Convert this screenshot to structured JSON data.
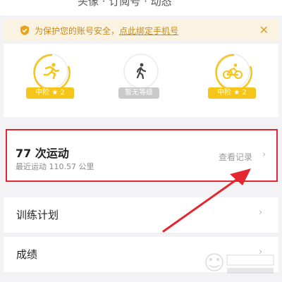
{
  "header": {
    "partial_text": "头像 · 订阅号 · 动态"
  },
  "notice": {
    "prefix": "为保护您的账号安全，",
    "link": "点此绑定手机号",
    "close_glyph": "✕"
  },
  "badges": [
    {
      "icon": "running-icon",
      "label": "中阶 ★ 2"
    },
    {
      "icon": "walking-icon",
      "label": "暂无等级"
    },
    {
      "icon": "cycling-icon",
      "label": "中阶 ★ 2"
    }
  ],
  "record": {
    "count": "77",
    "count_unit": "次运动",
    "recent_label": "最近运动",
    "recent_value": "110.57",
    "recent_unit": "公里",
    "view_label": "查看记录"
  },
  "list": [
    {
      "label": "训练计划"
    },
    {
      "label": "成绩"
    }
  ],
  "colors": {
    "accent": "#f6c51a",
    "highlight": "#e3262f",
    "notice_bg": "#fbf3e2",
    "notice_text": "#c98a1a"
  }
}
